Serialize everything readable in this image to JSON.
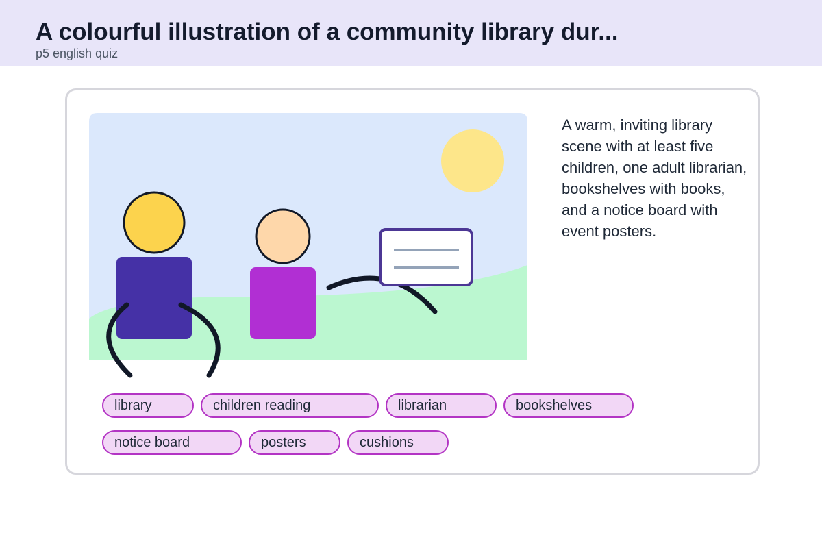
{
  "header": {
    "title": "A colourful illustration of a community library dur...",
    "subtitle": "p5 english quiz"
  },
  "card": {
    "description": "A warm, inviting library scene with at least five children, one adult librarian, bookshelves with books, and a notice board with event posters."
  },
  "tags": [
    "library",
    "children reading",
    "librarian",
    "bookshelves",
    "notice board",
    "posters",
    "cushions"
  ],
  "colors": {
    "header_bg": "#e8e5f9",
    "sky": "#dbe8fc",
    "grass": "#bbf7d0",
    "sun": "#fde68a",
    "head_yellow": "#fcd34d",
    "head_peach": "#fed7aa",
    "body_indigo": "#4531a6",
    "body_magenta": "#b12fd3",
    "board_border": "#4c3795",
    "tag_border": "#b334c4",
    "tag_bg": "#f2d7f6"
  }
}
